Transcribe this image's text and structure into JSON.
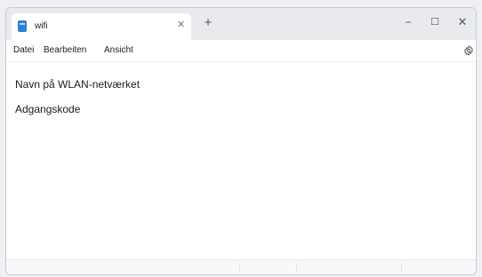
{
  "window": {
    "tab_title": "wifi",
    "tab_modified_indicator": "✕",
    "new_tab_label": "+",
    "minimize_glyph": "−",
    "maximize_glyph": "☐",
    "close_glyph": "✕"
  },
  "menu": {
    "items": [
      "Datei",
      "Bearbeiten",
      "Ansicht"
    ],
    "settings_icon": "gear-icon"
  },
  "editor": {
    "lines": [
      "Navn på WLAN-netværket",
      "Adgangskode"
    ]
  },
  "colors": {
    "accent": "#2e7fd6",
    "titlebar": "#e8eaee",
    "window": "#ffffff"
  }
}
